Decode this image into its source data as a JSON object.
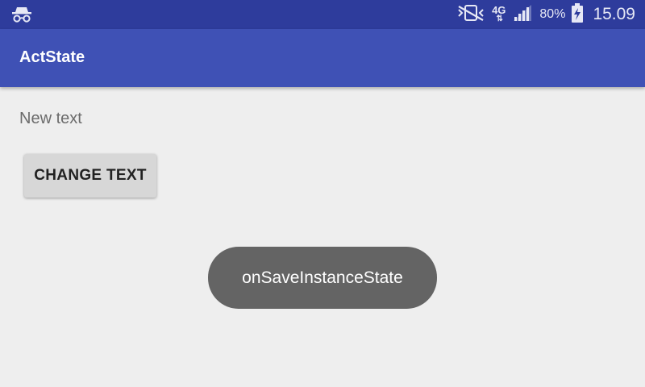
{
  "status_bar": {
    "left_icons": [
      "incognito-icon"
    ],
    "right_icons": [
      "vibrate-mute-icon",
      "mobile-data-icon",
      "signal-icon",
      "battery-charging-icon"
    ],
    "network_type": "4G",
    "network_arrows": "⇅",
    "battery_percent": "80%",
    "time": "15.09"
  },
  "toolbar": {
    "title": "ActState"
  },
  "content": {
    "text": "New text",
    "button_label": "CHANGE TEXT"
  },
  "toast": {
    "message": "onSaveInstanceState"
  },
  "colors": {
    "status_bar": "#2e3c9c",
    "toolbar": "#3f51b5",
    "background": "#eeeeee",
    "button": "#d7d7d7",
    "toast": "#646464"
  }
}
